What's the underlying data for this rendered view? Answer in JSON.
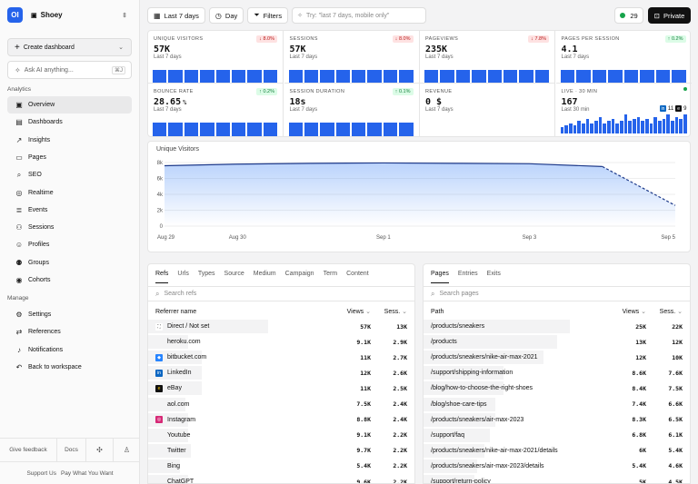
{
  "app": {
    "logo_text": "OI",
    "project": "Shoey"
  },
  "sidebar": {
    "create_dashboard": "Create dashboard",
    "ask_placeholder": "Ask AI anything...",
    "ask_shortcut": "⌘J",
    "section_analytics": "Analytics",
    "analytics_items": [
      {
        "label": "Overview",
        "icon": "overview-icon"
      },
      {
        "label": "Dashboards",
        "icon": "dashboards-icon"
      },
      {
        "label": "Insights",
        "icon": "insights-icon"
      },
      {
        "label": "Pages",
        "icon": "pages-icon"
      },
      {
        "label": "SEO",
        "icon": "seo-icon"
      },
      {
        "label": "Realtime",
        "icon": "realtime-icon"
      },
      {
        "label": "Events",
        "icon": "events-icon"
      },
      {
        "label": "Sessions",
        "icon": "sessions-icon"
      },
      {
        "label": "Profiles",
        "icon": "profiles-icon"
      },
      {
        "label": "Groups",
        "icon": "groups-icon"
      },
      {
        "label": "Cohorts",
        "icon": "cohorts-icon"
      }
    ],
    "section_manage": "Manage",
    "manage_items": [
      {
        "label": "Settings",
        "icon": "settings-icon"
      },
      {
        "label": "References",
        "icon": "references-icon"
      },
      {
        "label": "Notifications",
        "icon": "notifications-icon"
      },
      {
        "label": "Back to workspace",
        "icon": "back-icon"
      }
    ],
    "give_feedback": "Give feedback",
    "docs": "Docs",
    "support": "Support Us",
    "pay": "Pay What You Want"
  },
  "topbar": {
    "range": "Last 7 days",
    "interval": "Day",
    "filters": "Filters",
    "search_placeholder": "Try: \"last 7 days, mobile only\"",
    "live_count": "29",
    "private": "Private"
  },
  "metrics": [
    {
      "label": "UNIQUE VISITORS",
      "value": "57K",
      "sub": "Last 7 days",
      "change": "8.0%",
      "dir": "down",
      "bars": [
        0.8,
        0.8,
        0.8,
        0.8,
        0.8,
        0.8,
        0.8,
        0.8
      ]
    },
    {
      "label": "SESSIONS",
      "value": "57K",
      "sub": "Last 7 days",
      "change": "8.0%",
      "dir": "down",
      "bars": [
        0.8,
        0.8,
        0.8,
        0.8,
        0.8,
        0.8,
        0.8,
        0.8
      ]
    },
    {
      "label": "PAGEVIEWS",
      "value": "235K",
      "sub": "Last 7 days",
      "change": "7.8%",
      "dir": "down",
      "bars": [
        0.8,
        0.8,
        0.8,
        0.8,
        0.8,
        0.8,
        0.8,
        0.8
      ]
    },
    {
      "label": "PAGES PER SESSION",
      "value": "4.1",
      "sub": "Last 7 days",
      "change": "0.2%",
      "dir": "up",
      "bars": [
        0.8,
        0.8,
        0.8,
        0.8,
        0.8,
        0.8,
        0.8,
        0.8
      ]
    },
    {
      "label": "BOUNCE RATE",
      "value": "28.65",
      "unit": "%",
      "sub": "Last 7 days",
      "change": "0.2%",
      "dir": "up",
      "bars": [
        0.9,
        0.9,
        0.9,
        0.9,
        0.9,
        0.9,
        0.9,
        0.9
      ]
    },
    {
      "label": "SESSION DURATION",
      "value": "18s",
      "sub": "Last 7 days",
      "change": "0.1%",
      "dir": "up",
      "bars": [
        0.9,
        0.9,
        0.9,
        0.9,
        0.9,
        0.9,
        0.9,
        0.9
      ]
    },
    {
      "label": "REVENUE",
      "value": "0 $",
      "sub": "Last 7 days"
    },
    {
      "label": "LIVE · 30 MIN",
      "value": "167",
      "sub": "Last 30 min",
      "live_icons": [
        {
          "icon": "linkedin-icon",
          "count": "11"
        },
        {
          "icon": "ebay-icon",
          "count": "9"
        }
      ]
    }
  ],
  "live_bars": [
    0.3,
    0.4,
    0.5,
    0.4,
    0.6,
    0.5,
    0.7,
    0.5,
    0.6,
    0.8,
    0.5,
    0.6,
    0.7,
    0.5,
    0.6,
    0.9,
    0.6,
    0.7,
    0.8,
    0.6,
    0.7,
    0.5,
    0.8,
    0.6,
    0.7,
    0.9,
    0.6,
    0.8,
    0.7,
    0.9
  ],
  "chart_data": {
    "type": "area",
    "title": "Unique Visitors",
    "x": [
      "Aug 29",
      "Aug 30",
      "Aug 31",
      "Sep 1",
      "Sep 2",
      "Sep 3",
      "Sep 4",
      "Sep 5"
    ],
    "x_ticks": [
      "Aug 29",
      "Aug 30",
      "Sep 1",
      "Sep 3",
      "Sep 5"
    ],
    "y_ticks": [
      "0",
      "2k",
      "4k",
      "6k",
      "8k"
    ],
    "values": [
      7600,
      7800,
      7900,
      7950,
      7900,
      7850,
      7500,
      2600
    ],
    "ylim": [
      0,
      8000
    ],
    "grid": true,
    "projected_tail": true
  },
  "refs": {
    "tabs": [
      "Refs",
      "Urls",
      "Types",
      "Source",
      "Medium",
      "Campaign",
      "Term",
      "Content"
    ],
    "search_placeholder": "Search refs",
    "col_name": "Referrer name",
    "col_views": "Views",
    "col_sess": "Sess.",
    "rows": [
      {
        "name": "Direct / Not set",
        "icon": "direct-icon",
        "views": "57K",
        "sess": "13K",
        "bar": 0.45
      },
      {
        "name": "heroku.com",
        "icon": "",
        "views": "9.1K",
        "sess": "2.9K",
        "bar": 0.15
      },
      {
        "name": "bitbucket.com",
        "icon": "bitbucket-icon",
        "views": "11K",
        "sess": "2.7K",
        "bar": 0.2
      },
      {
        "name": "LinkedIn",
        "icon": "linkedin-icon",
        "views": "12K",
        "sess": "2.6K",
        "bar": 0.2
      },
      {
        "name": "eBay",
        "icon": "ebay-icon",
        "views": "11K",
        "sess": "2.5K",
        "bar": 0.2
      },
      {
        "name": "aol.com",
        "icon": "",
        "views": "7.5K",
        "sess": "2.4K",
        "bar": 0.14
      },
      {
        "name": "Instagram",
        "icon": "instagram-icon",
        "views": "8.8K",
        "sess": "2.4K",
        "bar": 0.15
      },
      {
        "name": "Youtube",
        "icon": "",
        "views": "9.1K",
        "sess": "2.2K",
        "bar": 0.15
      },
      {
        "name": "Twitter",
        "icon": "",
        "views": "9.7K",
        "sess": "2.2K",
        "bar": 0.16
      },
      {
        "name": "Bing",
        "icon": "",
        "views": "5.4K",
        "sess": "2.2K",
        "bar": 0.12
      },
      {
        "name": "ChatGPT",
        "icon": "",
        "views": "9.6K",
        "sess": "2.2K",
        "bar": 0.15
      }
    ]
  },
  "pages": {
    "tabs": [
      "Pages",
      "Entries",
      "Exits"
    ],
    "search_placeholder": "Search pages",
    "col_name": "Path",
    "col_views": "Views",
    "col_sess": "Sess.",
    "rows": [
      {
        "name": "/products/sneakers",
        "views": "25K",
        "sess": "22K",
        "bar": 0.55
      },
      {
        "name": "/products",
        "views": "13K",
        "sess": "12K",
        "bar": 0.5
      },
      {
        "name": "/products/sneakers/nike-air-max-2021",
        "views": "12K",
        "sess": "10K",
        "bar": 0.45
      },
      {
        "name": "/support/shipping-information",
        "views": "8.6K",
        "sess": "7.6K",
        "bar": 0.3
      },
      {
        "name": "/blog/how-to-choose-the-right-shoes",
        "views": "8.4K",
        "sess": "7.5K",
        "bar": 0.3
      },
      {
        "name": "/blog/shoe-care-tips",
        "views": "7.4K",
        "sess": "6.6K",
        "bar": 0.27
      },
      {
        "name": "/products/sneakers/air-max-2023",
        "views": "8.3K",
        "sess": "6.5K",
        "bar": 0.27
      },
      {
        "name": "/support/faq",
        "views": "6.8K",
        "sess": "6.1K",
        "bar": 0.25
      },
      {
        "name": "/products/sneakers/nike-air-max-2021/details",
        "views": "6K",
        "sess": "5.4K",
        "bar": 0.23
      },
      {
        "name": "/products/sneakers/air-max-2023/details",
        "views": "5.4K",
        "sess": "4.6K",
        "bar": 0.2
      },
      {
        "name": "/support/return-policy",
        "views": "5K",
        "sess": "4.5K",
        "bar": 0.19
      }
    ]
  }
}
